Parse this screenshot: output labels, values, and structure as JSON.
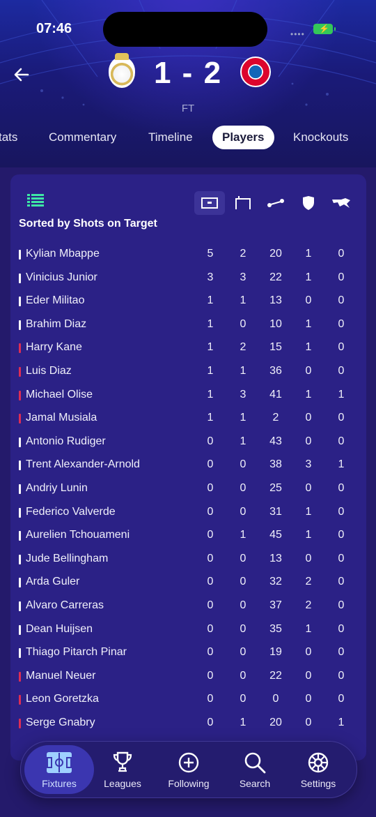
{
  "status_bar": {
    "time": "07:46"
  },
  "match": {
    "home_score": "1",
    "separator": "-",
    "away_score": "2",
    "status": "FT"
  },
  "tabs": [
    {
      "label": "tats",
      "active": false
    },
    {
      "label": "Commentary",
      "active": false
    },
    {
      "label": "Timeline",
      "active": false
    },
    {
      "label": "Players",
      "active": true
    },
    {
      "label": "Knockouts",
      "active": false
    }
  ],
  "player_stats": {
    "sort_label": "Sorted by Shots on Target",
    "column_icons": [
      "goal-frame-icon",
      "goalpost-icon",
      "pass-icon",
      "shield-icon",
      "tackle-icon"
    ],
    "team_colors": {
      "home": "#ffffff",
      "away": "#dc2d55"
    },
    "rows": [
      {
        "name": "Kylian Mbappe",
        "team": "home",
        "values": [
          "5",
          "2",
          "20",
          "1",
          "0"
        ]
      },
      {
        "name": "Vinicius Junior",
        "team": "home",
        "values": [
          "3",
          "3",
          "22",
          "1",
          "0"
        ]
      },
      {
        "name": "Eder Militao",
        "team": "home",
        "values": [
          "1",
          "1",
          "13",
          "0",
          "0"
        ]
      },
      {
        "name": "Brahim Diaz",
        "team": "home",
        "values": [
          "1",
          "0",
          "10",
          "1",
          "0"
        ]
      },
      {
        "name": "Harry Kane",
        "team": "away",
        "values": [
          "1",
          "2",
          "15",
          "1",
          "0"
        ]
      },
      {
        "name": "Luis Diaz",
        "team": "away",
        "values": [
          "1",
          "1",
          "36",
          "0",
          "0"
        ]
      },
      {
        "name": "Michael Olise",
        "team": "away",
        "values": [
          "1",
          "3",
          "41",
          "1",
          "1"
        ]
      },
      {
        "name": "Jamal Musiala",
        "team": "away",
        "values": [
          "1",
          "1",
          "2",
          "0",
          "0"
        ]
      },
      {
        "name": "Antonio Rudiger",
        "team": "home",
        "values": [
          "0",
          "1",
          "43",
          "0",
          "0"
        ]
      },
      {
        "name": "Trent Alexander-Arnold",
        "team": "home",
        "values": [
          "0",
          "0",
          "38",
          "3",
          "1"
        ]
      },
      {
        "name": "Andriy Lunin",
        "team": "home",
        "values": [
          "0",
          "0",
          "25",
          "0",
          "0"
        ]
      },
      {
        "name": "Federico Valverde",
        "team": "home",
        "values": [
          "0",
          "0",
          "31",
          "1",
          "0"
        ]
      },
      {
        "name": "Aurelien Tchouameni",
        "team": "home",
        "values": [
          "0",
          "1",
          "45",
          "1",
          "0"
        ]
      },
      {
        "name": "Jude Bellingham",
        "team": "home",
        "values": [
          "0",
          "0",
          "13",
          "0",
          "0"
        ]
      },
      {
        "name": "Arda Guler",
        "team": "home",
        "values": [
          "0",
          "0",
          "32",
          "2",
          "0"
        ]
      },
      {
        "name": "Alvaro Carreras",
        "team": "home",
        "values": [
          "0",
          "0",
          "37",
          "2",
          "0"
        ]
      },
      {
        "name": "Dean Huijsen",
        "team": "home",
        "values": [
          "0",
          "0",
          "35",
          "1",
          "0"
        ]
      },
      {
        "name": "Thiago Pitarch Pinar",
        "team": "home",
        "values": [
          "0",
          "0",
          "19",
          "0",
          "0"
        ]
      },
      {
        "name": "Manuel Neuer",
        "team": "away",
        "values": [
          "0",
          "0",
          "22",
          "0",
          "0"
        ]
      },
      {
        "name": "Leon Goretzka",
        "team": "away",
        "values": [
          "0",
          "0",
          "0",
          "0",
          "0"
        ]
      },
      {
        "name": "Serge Gnabry",
        "team": "away",
        "values": [
          "0",
          "1",
          "20",
          "0",
          "1"
        ]
      }
    ]
  },
  "bottom_nav": [
    {
      "label": "Fixtures",
      "icon": "pitch-icon",
      "active": true
    },
    {
      "label": "Leagues",
      "icon": "trophy-icon",
      "active": false
    },
    {
      "label": "Following",
      "icon": "plus-circle-icon",
      "active": false
    },
    {
      "label": "Search",
      "icon": "search-icon",
      "active": false
    },
    {
      "label": "Settings",
      "icon": "gear-icon",
      "active": false
    }
  ]
}
